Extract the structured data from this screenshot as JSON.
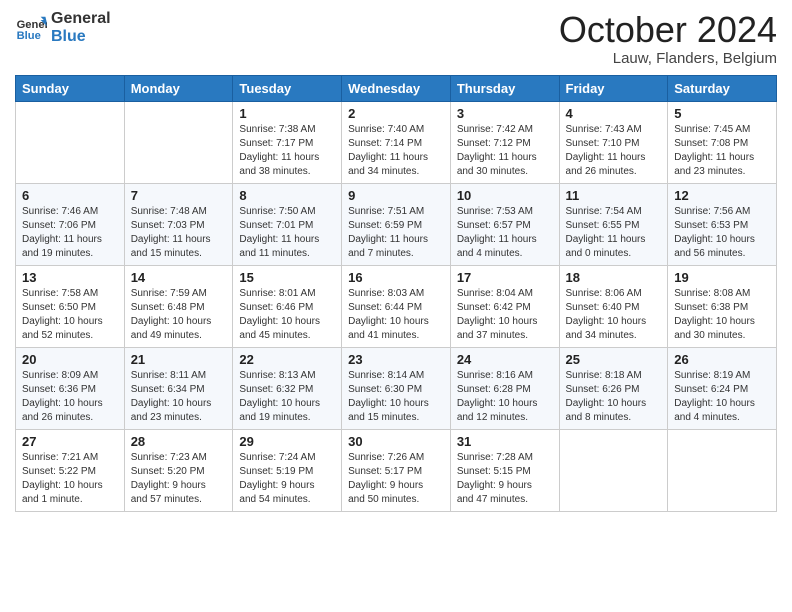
{
  "header": {
    "logo_line1": "General",
    "logo_line2": "Blue",
    "month": "October 2024",
    "location": "Lauw, Flanders, Belgium"
  },
  "weekdays": [
    "Sunday",
    "Monday",
    "Tuesday",
    "Wednesday",
    "Thursday",
    "Friday",
    "Saturday"
  ],
  "weeks": [
    [
      {
        "day": "",
        "info": ""
      },
      {
        "day": "",
        "info": ""
      },
      {
        "day": "1",
        "info": "Sunrise: 7:38 AM\nSunset: 7:17 PM\nDaylight: 11 hours\nand 38 minutes."
      },
      {
        "day": "2",
        "info": "Sunrise: 7:40 AM\nSunset: 7:14 PM\nDaylight: 11 hours\nand 34 minutes."
      },
      {
        "day": "3",
        "info": "Sunrise: 7:42 AM\nSunset: 7:12 PM\nDaylight: 11 hours\nand 30 minutes."
      },
      {
        "day": "4",
        "info": "Sunrise: 7:43 AM\nSunset: 7:10 PM\nDaylight: 11 hours\nand 26 minutes."
      },
      {
        "day": "5",
        "info": "Sunrise: 7:45 AM\nSunset: 7:08 PM\nDaylight: 11 hours\nand 23 minutes."
      }
    ],
    [
      {
        "day": "6",
        "info": "Sunrise: 7:46 AM\nSunset: 7:06 PM\nDaylight: 11 hours\nand 19 minutes."
      },
      {
        "day": "7",
        "info": "Sunrise: 7:48 AM\nSunset: 7:03 PM\nDaylight: 11 hours\nand 15 minutes."
      },
      {
        "day": "8",
        "info": "Sunrise: 7:50 AM\nSunset: 7:01 PM\nDaylight: 11 hours\nand 11 minutes."
      },
      {
        "day": "9",
        "info": "Sunrise: 7:51 AM\nSunset: 6:59 PM\nDaylight: 11 hours\nand 7 minutes."
      },
      {
        "day": "10",
        "info": "Sunrise: 7:53 AM\nSunset: 6:57 PM\nDaylight: 11 hours\nand 4 minutes."
      },
      {
        "day": "11",
        "info": "Sunrise: 7:54 AM\nSunset: 6:55 PM\nDaylight: 11 hours\nand 0 minutes."
      },
      {
        "day": "12",
        "info": "Sunrise: 7:56 AM\nSunset: 6:53 PM\nDaylight: 10 hours\nand 56 minutes."
      }
    ],
    [
      {
        "day": "13",
        "info": "Sunrise: 7:58 AM\nSunset: 6:50 PM\nDaylight: 10 hours\nand 52 minutes."
      },
      {
        "day": "14",
        "info": "Sunrise: 7:59 AM\nSunset: 6:48 PM\nDaylight: 10 hours\nand 49 minutes."
      },
      {
        "day": "15",
        "info": "Sunrise: 8:01 AM\nSunset: 6:46 PM\nDaylight: 10 hours\nand 45 minutes."
      },
      {
        "day": "16",
        "info": "Sunrise: 8:03 AM\nSunset: 6:44 PM\nDaylight: 10 hours\nand 41 minutes."
      },
      {
        "day": "17",
        "info": "Sunrise: 8:04 AM\nSunset: 6:42 PM\nDaylight: 10 hours\nand 37 minutes."
      },
      {
        "day": "18",
        "info": "Sunrise: 8:06 AM\nSunset: 6:40 PM\nDaylight: 10 hours\nand 34 minutes."
      },
      {
        "day": "19",
        "info": "Sunrise: 8:08 AM\nSunset: 6:38 PM\nDaylight: 10 hours\nand 30 minutes."
      }
    ],
    [
      {
        "day": "20",
        "info": "Sunrise: 8:09 AM\nSunset: 6:36 PM\nDaylight: 10 hours\nand 26 minutes."
      },
      {
        "day": "21",
        "info": "Sunrise: 8:11 AM\nSunset: 6:34 PM\nDaylight: 10 hours\nand 23 minutes."
      },
      {
        "day": "22",
        "info": "Sunrise: 8:13 AM\nSunset: 6:32 PM\nDaylight: 10 hours\nand 19 minutes."
      },
      {
        "day": "23",
        "info": "Sunrise: 8:14 AM\nSunset: 6:30 PM\nDaylight: 10 hours\nand 15 minutes."
      },
      {
        "day": "24",
        "info": "Sunrise: 8:16 AM\nSunset: 6:28 PM\nDaylight: 10 hours\nand 12 minutes."
      },
      {
        "day": "25",
        "info": "Sunrise: 8:18 AM\nSunset: 6:26 PM\nDaylight: 10 hours\nand 8 minutes."
      },
      {
        "day": "26",
        "info": "Sunrise: 8:19 AM\nSunset: 6:24 PM\nDaylight: 10 hours\nand 4 minutes."
      }
    ],
    [
      {
        "day": "27",
        "info": "Sunrise: 7:21 AM\nSunset: 5:22 PM\nDaylight: 10 hours\nand 1 minute."
      },
      {
        "day": "28",
        "info": "Sunrise: 7:23 AM\nSunset: 5:20 PM\nDaylight: 9 hours\nand 57 minutes."
      },
      {
        "day": "29",
        "info": "Sunrise: 7:24 AM\nSunset: 5:19 PM\nDaylight: 9 hours\nand 54 minutes."
      },
      {
        "day": "30",
        "info": "Sunrise: 7:26 AM\nSunset: 5:17 PM\nDaylight: 9 hours\nand 50 minutes."
      },
      {
        "day": "31",
        "info": "Sunrise: 7:28 AM\nSunset: 5:15 PM\nDaylight: 9 hours\nand 47 minutes."
      },
      {
        "day": "",
        "info": ""
      },
      {
        "day": "",
        "info": ""
      }
    ]
  ]
}
